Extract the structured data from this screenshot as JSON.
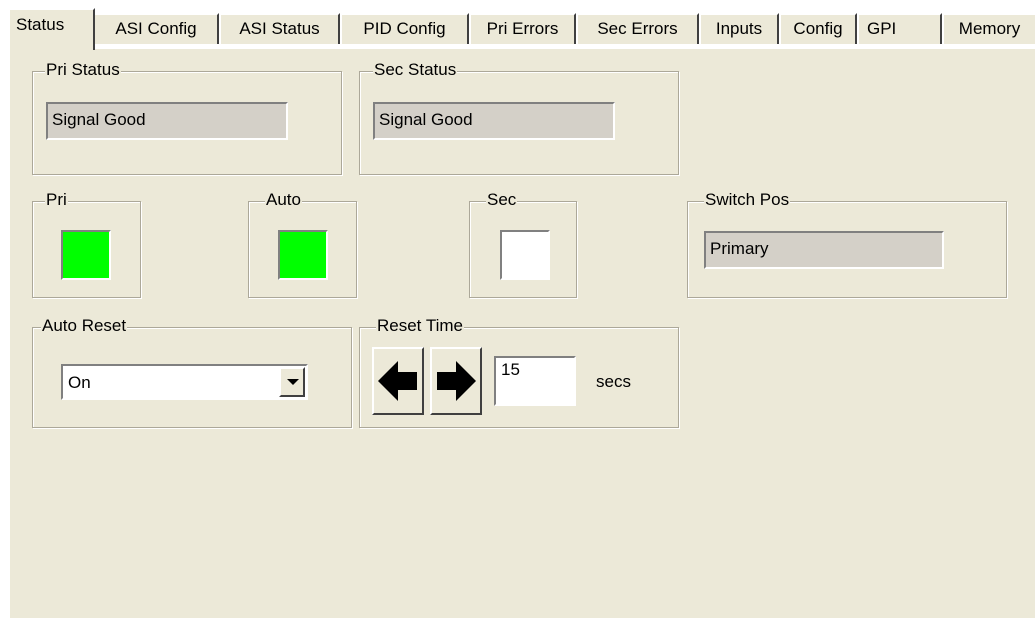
{
  "tabs": [
    {
      "label": "Status"
    },
    {
      "label": "ASI Config"
    },
    {
      "label": "ASI Status"
    },
    {
      "label": "PID Config"
    },
    {
      "label": "Pri Errors"
    },
    {
      "label": "Sec Errors"
    },
    {
      "label": "Inputs"
    },
    {
      "label": "Config"
    },
    {
      "label": "GPI"
    },
    {
      "label": "Memory"
    }
  ],
  "active_tab": "Status",
  "pri_status": {
    "label": "Pri Status",
    "value": "Signal Good"
  },
  "sec_status": {
    "label": "Sec Status",
    "value": "Signal Good"
  },
  "indicators": {
    "pri": {
      "label": "Pri",
      "color": "#00ff00"
    },
    "auto": {
      "label": "Auto",
      "color": "#00ff00"
    },
    "sec": {
      "label": "Sec",
      "color": "#ffffff"
    }
  },
  "switch_pos": {
    "label": "Switch Pos",
    "value": "Primary"
  },
  "auto_reset": {
    "label": "Auto Reset",
    "selected": "On"
  },
  "reset_time": {
    "label": "Reset Time",
    "value": "15",
    "unit": "secs"
  },
  "colors": {
    "panel_bg": "#ece9d8",
    "readonly_bg": "#d4d0c8",
    "led_on": "#00ff00",
    "led_off": "#ffffff"
  },
  "icons": {
    "decrease": "left-arrow-icon",
    "increase": "right-arrow-icon",
    "dropdown": "chevron-down-icon"
  }
}
